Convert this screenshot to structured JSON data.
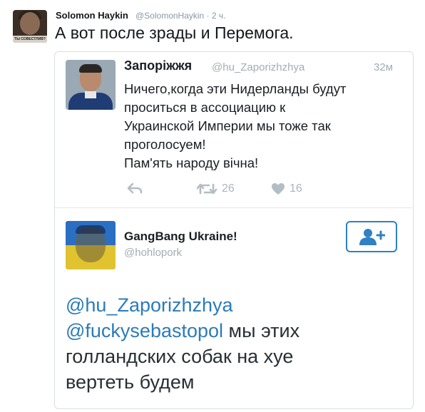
{
  "outer_tweet": {
    "avatar_caption": "ТЫ СОВЕСТЛИВ?",
    "name": "Solomon Haykin",
    "handle_time": "@SolomonHaykin · 2 ч.",
    "text": "А вот после зрады и Перемога."
  },
  "quoted_tweet": {
    "name": "Запоріжжя",
    "handle": "@hu_Zaporizhzhya",
    "time": "32м",
    "text_lines": [
      "Ничего,когда эти Нидерланды будут",
      "проситься в ассоциацию к",
      "Украинской Империи мы тоже так",
      "проголосуем!",
      "Пам'ять народу вічна!"
    ],
    "retweet_count": "26",
    "like_count": "16",
    "icons": [
      "reply-icon",
      "retweet-icon",
      "heart-icon"
    ]
  },
  "reply_tweet": {
    "name": "GangBang Ukraine!",
    "handle": "@hohlopork",
    "mention_1": "@hu_Zaporizhzhya",
    "mention_2": "@fuckysebastopol",
    "line_2_rest": " мы этих",
    "line_3": "голландских собак на хуе",
    "line_4": "вертеть будем"
  },
  "colors": {
    "link": "#2b7bb9",
    "follow_button": "#2f80c4",
    "muted": "#a2adb5"
  }
}
